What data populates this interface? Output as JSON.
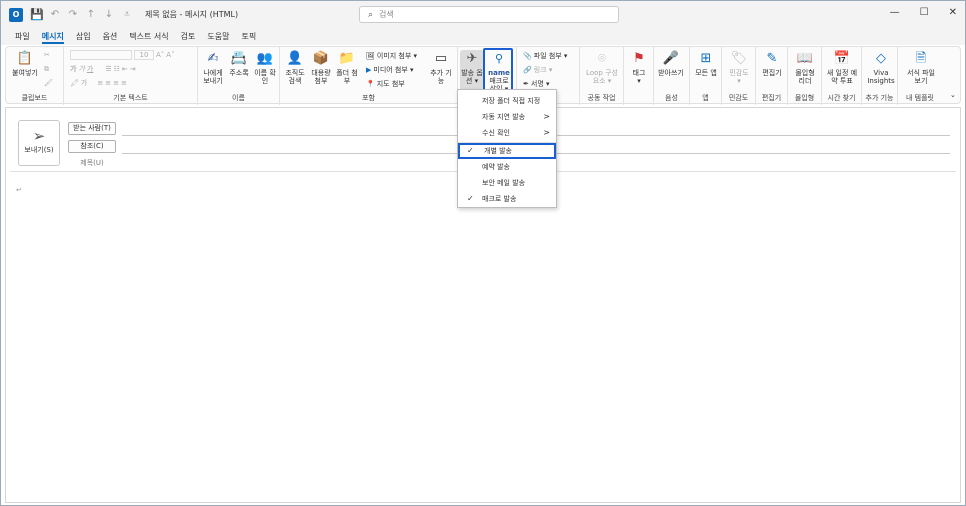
{
  "titlebar": {
    "title": "제목 없음 - 메시지 (HTML)",
    "search_placeholder": "검색",
    "min": "—",
    "restore": "☐",
    "close": "✕"
  },
  "tabs": [
    "파일",
    "메시지",
    "삽입",
    "옵션",
    "텍스트 서식",
    "검토",
    "도움말",
    "토픽"
  ],
  "ribbon": {
    "clipboard": {
      "paste": "붙여넣기",
      "label": "클립보드"
    },
    "basic_text": {
      "label": "기본 텍스트",
      "font_size": "10"
    },
    "names": {
      "send_to_me": "나에게 보내기",
      "address_book": "주소록",
      "check_names": "이름 확인",
      "label": "이름"
    },
    "include": {
      "org": "조직도 검색",
      "large_file": "대용량 첨부",
      "folder": "폴더 첨부",
      "image_attach": "이미지 첨부 ▾",
      "media_attach": "미디어 첨부 ▾",
      "map_attach": "지도 첨부",
      "addin": "추가 기능",
      "label": "포함"
    },
    "send_options": {
      "label": "발송 옵션 ▾"
    },
    "macro": {
      "name": "name",
      "label": "매크로 삽입 ▾"
    },
    "attach": {
      "file": "파일 첨부 ▾",
      "link": "링크 ▾",
      "signature": "서명 ▾"
    },
    "loop": {
      "label": "Loop 구성 요소 ▾",
      "group": "공동 작업"
    },
    "tag": {
      "label": "태그",
      "arrow": "▾"
    },
    "voice": {
      "dictate": "받아쓰기",
      "group": "음성"
    },
    "apps": {
      "all": "모든 앱",
      "group": "앱"
    },
    "sensitivity": {
      "label": "민감도",
      "arrow": "▾",
      "group": "민감도"
    },
    "editor": {
      "label": "편집기",
      "group": "편집기"
    },
    "immersive": {
      "label": "몰입형 리더",
      "group": "몰입형"
    },
    "schedule": {
      "label": "새 일정 예약 투표",
      "group": "시간 찾기"
    },
    "viva": {
      "label": "Viva Insights",
      "group": "추가 기능"
    },
    "template": {
      "label": "서식 파일 보기",
      "group": "내 템플릿"
    }
  },
  "compose": {
    "send": "보내기(S)",
    "to": "받는 사람(T)",
    "cc": "참조(C)",
    "subject": "제목(U)",
    "body_mark": "↵"
  },
  "menu": {
    "items": [
      {
        "label": "저장 폴더 직접 지정",
        "checked": false,
        "submenu": false
      },
      {
        "label": "자동 지연 발송",
        "checked": false,
        "submenu": true
      },
      {
        "label": "수신 확인",
        "checked": false,
        "submenu": true
      },
      {
        "label": "개별 발송",
        "checked": true,
        "submenu": false,
        "selected": true
      },
      {
        "label": "예약 발송",
        "checked": false,
        "submenu": false
      },
      {
        "label": "보안 메일 발송",
        "checked": false,
        "submenu": false
      },
      {
        "label": "매크로 발송",
        "checked": true,
        "submenu": false
      }
    ],
    "check_glyph": "✓",
    "arrow_glyph": ">"
  },
  "colors": {
    "accent": "#0f6cbd",
    "highlight": "#1a5fd1"
  }
}
